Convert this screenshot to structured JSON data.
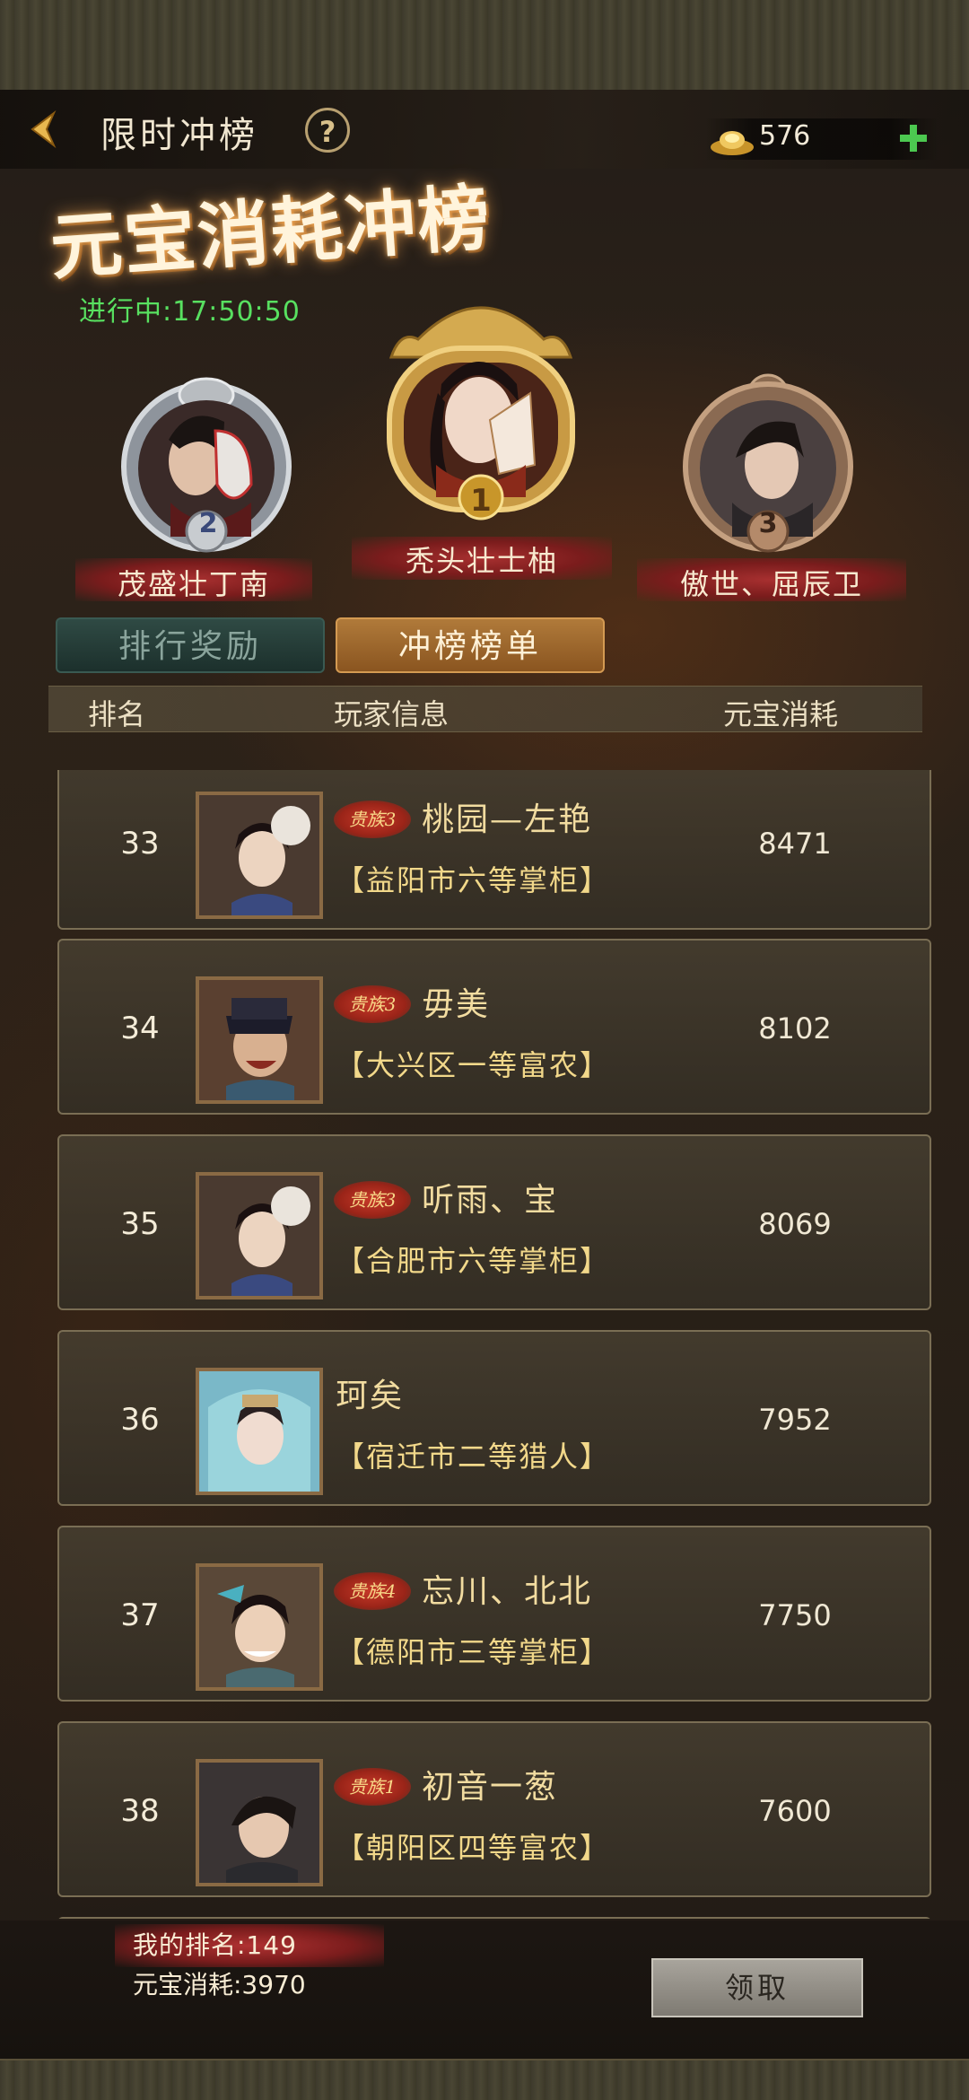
{
  "header": {
    "title": "限时冲榜",
    "currency_value": "576"
  },
  "event": {
    "title": "元宝消耗冲榜",
    "countdown": "进行中:17:50:50"
  },
  "podium": {
    "first": {
      "rank": "1",
      "name": "秃头壮士柚"
    },
    "second": {
      "rank": "2",
      "name": "茂盛壮丁南"
    },
    "third": {
      "rank": "3",
      "name": "傲世、屈辰卫"
    }
  },
  "tabs": {
    "rewards": "排行奖励",
    "board": "冲榜榜单"
  },
  "columns": {
    "rank": "排名",
    "player": "玩家信息",
    "consume": "元宝消耗"
  },
  "rows": [
    {
      "rank": "33",
      "badge": "贵族3",
      "name": "桃园—左艳",
      "title": "【益阳市六等掌柜】",
      "amount": "8471"
    },
    {
      "rank": "34",
      "badge": "贵族3",
      "name": "毋美",
      "title": "【大兴区一等富农】",
      "amount": "8102"
    },
    {
      "rank": "35",
      "badge": "贵族3",
      "name": "听雨、宝",
      "title": "【合肥市六等掌柜】",
      "amount": "8069"
    },
    {
      "rank": "36",
      "badge": "",
      "name": "珂矣",
      "title": "【宿迁市二等猎人】",
      "amount": "7952"
    },
    {
      "rank": "37",
      "badge": "贵族4",
      "name": "忘川、北北",
      "title": "【德阳市三等掌柜】",
      "amount": "7750"
    },
    {
      "rank": "38",
      "badge": "贵族1",
      "name": "初音一葱",
      "title": "【朝阳区四等富农】",
      "amount": "7600"
    }
  ],
  "footer": {
    "my_rank": "我的排名:149",
    "my_consume": "元宝消耗:3970",
    "claim_label": "领取"
  }
}
